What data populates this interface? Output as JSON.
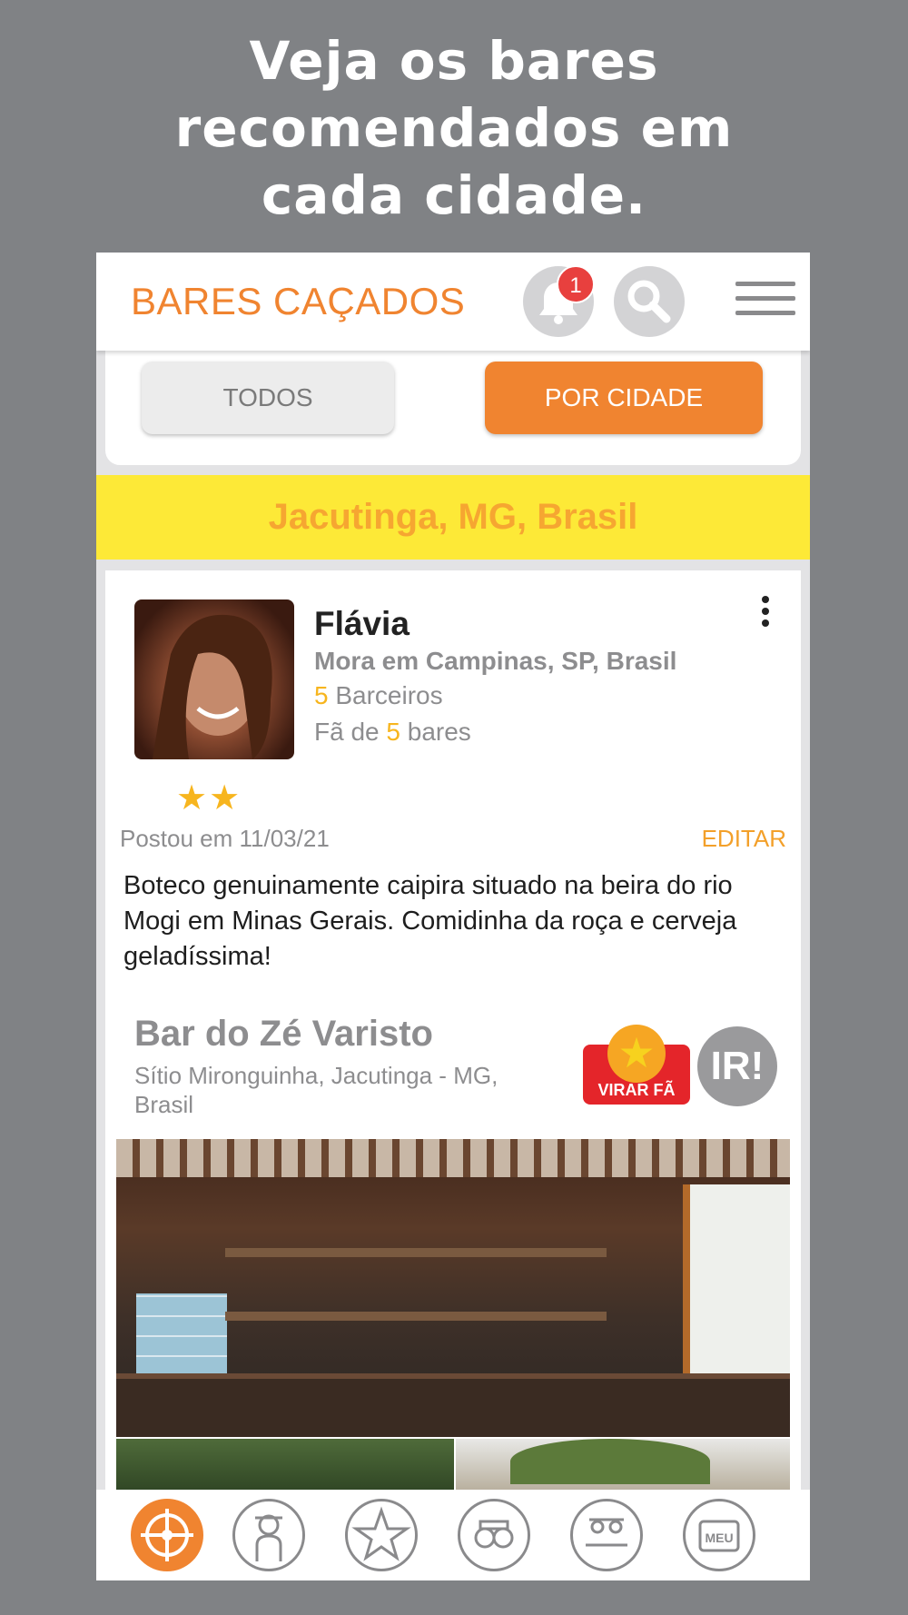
{
  "promo": {
    "headline_line1": "Veja os bares",
    "headline_line2": "recomendados em",
    "headline_line3": "cada cidade."
  },
  "appbar": {
    "title": "BARES CAÇADOS",
    "notification_count": "1",
    "icons": [
      "bell-icon",
      "search-icon",
      "menu-icon"
    ]
  },
  "filters": {
    "all_label": "TODOS",
    "by_city_label": "POR CIDADE",
    "selected": "POR CIDADE"
  },
  "city": {
    "name": "Jacutinga, MG, Brasil"
  },
  "post": {
    "author": {
      "name": "Flávia",
      "location": "Mora em Campinas, SP, Brasil",
      "barceiros_count": "5",
      "barceiros_label": " Barceiros",
      "fan_prefix": "Fã de ",
      "fan_count": "5",
      "fan_suffix": " bares"
    },
    "rating_stars": 2,
    "stars_text": "★★",
    "posted_text": "Postou em 11/03/21",
    "edit_label": "EDITAR",
    "text": "Boteco genuinamente caipira situado na beira do rio Mogi em Minas Gerais. Comidinha da roça e cerveja geladíssima!",
    "bar": {
      "name": "Bar do Zé Varisto",
      "address": "Sítio Mironguinha, Jacutinga - MG, Brasil",
      "fan_button_label": "VIRAR FÃ",
      "fan_star": "★",
      "go_button_label": "IR!"
    }
  },
  "tabbar": {
    "items": [
      "target-icon",
      "hunter-icon",
      "star-icon",
      "glasses-icon",
      "friends-icon",
      "meu-icon"
    ],
    "meu_label": "MEU",
    "active": "target-icon"
  },
  "colors": {
    "accent": "#f08430",
    "city_bar": "#fde937",
    "badge": "#e8403e",
    "star": "#f7b51e",
    "fan_button": "#e4252a",
    "background": "#808285"
  }
}
